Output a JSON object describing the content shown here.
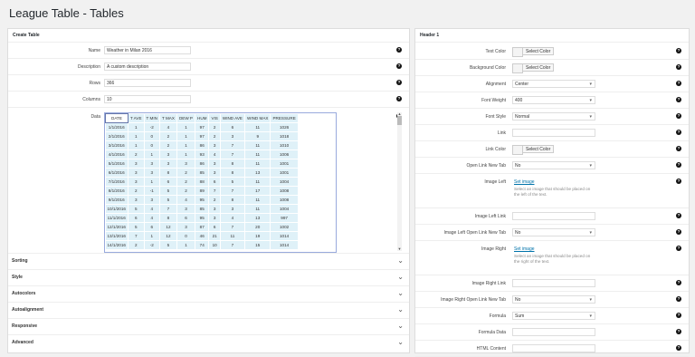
{
  "page": {
    "title": "League Table - Tables"
  },
  "left": {
    "header": "Create Table",
    "fields": [
      {
        "label": "Name",
        "value": "Weather in Milan 2016"
      },
      {
        "label": "Description",
        "value": "A custom description"
      },
      {
        "label": "Rows",
        "value": "366"
      },
      {
        "label": "Columns",
        "value": "10"
      }
    ],
    "data_label": "Data",
    "grid": {
      "headers": [
        "DATE",
        "T AVE",
        "T MIN",
        "T MAX",
        "DEW P",
        "HUM",
        "VIS",
        "WIND AVE",
        "WIND MAX",
        "PRESSURE"
      ],
      "rows": [
        [
          "1/1/2016",
          "1",
          "-2",
          "4",
          "1",
          "97",
          "2",
          "6",
          "11",
          "1026"
        ],
        [
          "2/1/2016",
          "1",
          "0",
          "2",
          "1",
          "97",
          "2",
          "3",
          "9",
          "1018"
        ],
        [
          "3/1/2016",
          "1",
          "0",
          "2",
          "1",
          "86",
          "3",
          "7",
          "11",
          "1010"
        ],
        [
          "4/1/2016",
          "2",
          "1",
          "3",
          "1",
          "93",
          "4",
          "7",
          "11",
          "1006"
        ],
        [
          "5/1/2016",
          "3",
          "3",
          "3",
          "3",
          "86",
          "3",
          "8",
          "11",
          "1001"
        ],
        [
          "6/1/2016",
          "3",
          "3",
          "8",
          "2",
          "85",
          "3",
          "8",
          "13",
          "1001"
        ],
        [
          "7/1/2016",
          "3",
          "1",
          "6",
          "2",
          "88",
          "6",
          "5",
          "11",
          "1004"
        ],
        [
          "8/1/2016",
          "2",
          "-1",
          "5",
          "2",
          "89",
          "7",
          "7",
          "17",
          "1008"
        ],
        [
          "9/1/2016",
          "3",
          "3",
          "5",
          "4",
          "95",
          "2",
          "8",
          "11",
          "1008"
        ],
        [
          "10/1/2016",
          "5",
          "4",
          "7",
          "3",
          "85",
          "3",
          "3",
          "11",
          "1004"
        ],
        [
          "11/1/2016",
          "6",
          "4",
          "8",
          "6",
          "95",
          "3",
          "4",
          "13",
          "997"
        ],
        [
          "12/1/2016",
          "5",
          "6",
          "12",
          "3",
          "87",
          "6",
          "7",
          "20",
          "1002"
        ],
        [
          "13/1/2016",
          "7",
          "1",
          "12",
          "0",
          "46",
          "21",
          "11",
          "19",
          "1014"
        ],
        [
          "14/1/2016",
          "2",
          "-2",
          "5",
          "1",
          "74",
          "10",
          "7",
          "15",
          "1014"
        ]
      ]
    },
    "sections": [
      "Sorting",
      "Style",
      "Autocolors",
      "Autoalignment",
      "Responsive",
      "Advanced"
    ]
  },
  "right": {
    "header": "Header 1",
    "select_color_label": "Select Color",
    "rows": [
      {
        "label": "Text Color",
        "kind": "color"
      },
      {
        "label": "Background Color",
        "kind": "color"
      },
      {
        "label": "Alignment",
        "kind": "select",
        "value": "Center"
      },
      {
        "label": "Font Weight",
        "kind": "select",
        "value": "400"
      },
      {
        "label": "Font Style",
        "kind": "select",
        "value": "Normal"
      },
      {
        "label": "Link",
        "kind": "input",
        "value": ""
      },
      {
        "label": "Link Color",
        "kind": "color"
      },
      {
        "label": "Open Link New Tab",
        "kind": "select",
        "value": "No"
      },
      {
        "label": "Image Left",
        "kind": "image",
        "link": "Set image",
        "desc": "Select an image that should be placed on the left of the text."
      },
      {
        "label": "Image Left Link",
        "kind": "input",
        "value": ""
      },
      {
        "label": "Image Left Open Link New Tab",
        "kind": "select",
        "value": "No"
      },
      {
        "label": "Image Right",
        "kind": "image",
        "link": "Set image",
        "desc": "Select an image that should be placed on the right of the text."
      },
      {
        "label": "Image Right Link",
        "kind": "input",
        "value": ""
      },
      {
        "label": "Image Right Open Link New Tab",
        "kind": "select",
        "value": "No"
      },
      {
        "label": "Formula",
        "kind": "select",
        "value": "Sum"
      },
      {
        "label": "Formula Data",
        "kind": "input",
        "value": ""
      },
      {
        "label": "HTML Content",
        "kind": "input",
        "value": ""
      }
    ]
  },
  "help_glyph": "?",
  "chevron_glyph": "⌄"
}
